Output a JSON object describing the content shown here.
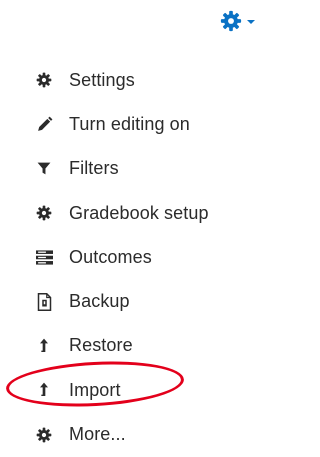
{
  "header": {
    "gear_icon": "gear-icon",
    "gear_color": "#0b72c4",
    "caret_icon": "chevron-down-icon"
  },
  "menu": {
    "items": [
      {
        "label": "Settings",
        "icon": "gear-icon"
      },
      {
        "label": "Turn editing on",
        "icon": "pencil-icon"
      },
      {
        "label": "Filters",
        "icon": "filter-icon"
      },
      {
        "label": "Gradebook setup",
        "icon": "gear-icon"
      },
      {
        "label": "Outcomes",
        "icon": "list-icon"
      },
      {
        "label": "Backup",
        "icon": "file-icon"
      },
      {
        "label": "Restore",
        "icon": "upload-arrow-icon"
      },
      {
        "label": "Import",
        "icon": "upload-arrow-icon"
      },
      {
        "label": "More...",
        "icon": "gear-icon"
      }
    ]
  },
  "annotation": {
    "highlighted_item": "Import",
    "color": "#e3001b"
  }
}
